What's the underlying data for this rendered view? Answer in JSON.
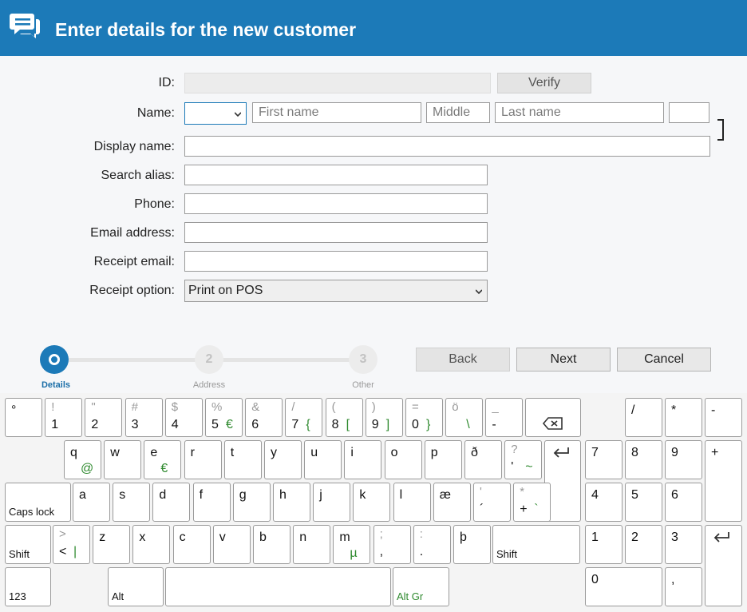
{
  "header": {
    "title": "Enter details for the new customer",
    "icon": "chat-bubbles-icon"
  },
  "form": {
    "id_label": "ID:",
    "verify_label": "Verify",
    "name_label": "Name:",
    "first_placeholder": "First name",
    "middle_placeholder": "Middle",
    "last_placeholder": "Last name",
    "display_label": "Display name:",
    "alias_label": "Search alias:",
    "phone_label": "Phone:",
    "email_label": "Email address:",
    "receipt_email_label": "Receipt email:",
    "receipt_option_label": "Receipt option:",
    "receipt_option_value": "Print on POS"
  },
  "steps": [
    {
      "num": "",
      "label": "Details"
    },
    {
      "num": "2",
      "label": "Address"
    },
    {
      "num": "3",
      "label": "Other"
    }
  ],
  "nav": {
    "back": "Back",
    "next": "Next",
    "cancel": "Cancel"
  },
  "keyboard": {
    "row1": [
      {
        "s": "",
        "m": "°"
      },
      {
        "s": "!",
        "m": "1"
      },
      {
        "s": "\"",
        "m": "2"
      },
      {
        "s": "#",
        "m": "3"
      },
      {
        "s": "$",
        "m": "4"
      },
      {
        "s": "%",
        "m": "5",
        "g": "€"
      },
      {
        "s": "&",
        "m": "6"
      },
      {
        "s": "/",
        "m": "7",
        "g": "{"
      },
      {
        "s": "(",
        "m": "8",
        "g": "["
      },
      {
        "s": ")",
        "m": "9",
        "g": "]"
      },
      {
        "s": "=",
        "m": "0",
        "g": "}"
      },
      {
        "s": "ö",
        "m": "",
        "g": "\\"
      },
      {
        "s": "_",
        "m": "-"
      }
    ],
    "row2": [
      {
        "m": "q",
        "g": "@"
      },
      {
        "m": "w"
      },
      {
        "m": "e",
        "g": "€"
      },
      {
        "m": "r"
      },
      {
        "m": "t"
      },
      {
        "m": "y"
      },
      {
        "m": "u"
      },
      {
        "m": "i"
      },
      {
        "m": "o"
      },
      {
        "m": "p"
      },
      {
        "m": "ð"
      },
      {
        "s": "?",
        "m": "'",
        "g": "~"
      }
    ],
    "row3": [
      {
        "m": "a"
      },
      {
        "m": "s"
      },
      {
        "m": "d"
      },
      {
        "m": "f"
      },
      {
        "m": "g"
      },
      {
        "m": "h"
      },
      {
        "m": "j"
      },
      {
        "m": "k"
      },
      {
        "m": "l"
      },
      {
        "m": "æ"
      },
      {
        "s": "'",
        "m": "´"
      },
      {
        "s": "*",
        "m": "+",
        "g": "`"
      }
    ],
    "row4": [
      {
        "s": ">",
        "m": "<",
        "g": "|"
      },
      {
        "m": "z"
      },
      {
        "m": "x"
      },
      {
        "m": "c"
      },
      {
        "m": "v"
      },
      {
        "m": "b"
      },
      {
        "m": "n"
      },
      {
        "m": "m",
        "g": "µ"
      },
      {
        "s": ";",
        "m": ","
      },
      {
        "s": ":",
        "m": "."
      },
      {
        "m": "þ"
      }
    ],
    "caps_lock": "Caps lock",
    "shift": "Shift",
    "mode_123": "123",
    "alt": "Alt",
    "alt_gr": "Alt Gr",
    "numpad": {
      "row1": [
        "/",
        "*",
        "-"
      ],
      "row2": [
        "7",
        "8",
        "9",
        "+"
      ],
      "row3": [
        "4",
        "5",
        "6"
      ],
      "row4": [
        "1",
        "2",
        "3"
      ],
      "row5": [
        "0",
        ","
      ]
    }
  }
}
